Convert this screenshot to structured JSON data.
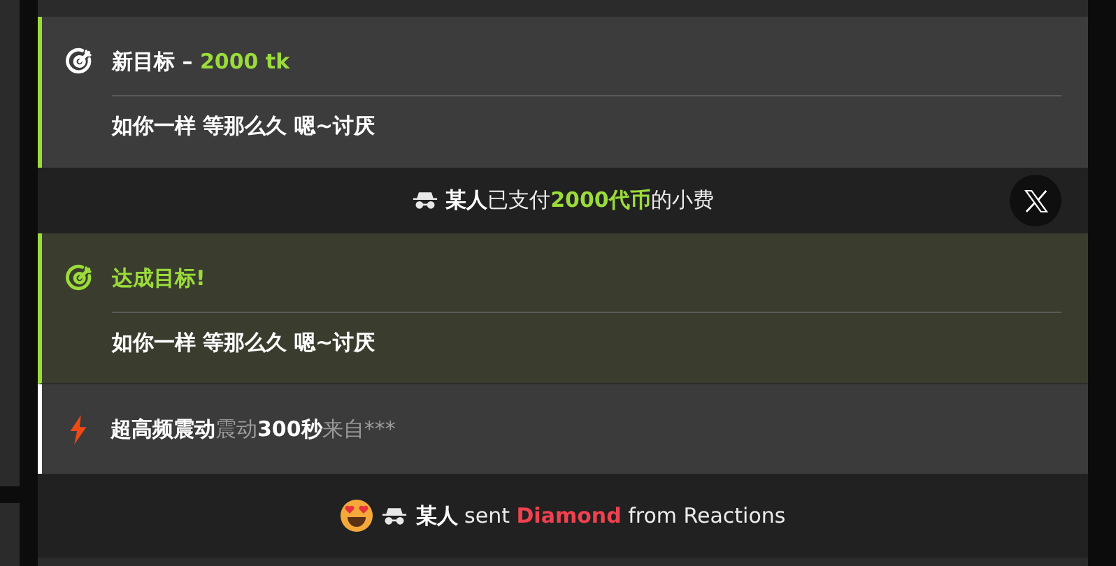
{
  "feed": [
    {
      "kind": "goal",
      "reached": false,
      "label": "新目标 – ",
      "target": "2000 tk",
      "message": "如你一样 等那么久 嗯~讨厌"
    },
    {
      "kind": "tip",
      "sender": "某人",
      "verb": "已支付",
      "amount": "2000代币",
      "suffix": "的小费"
    },
    {
      "kind": "goal",
      "reached": true,
      "label": "达成目标!",
      "message": "如你一样 等那么久 嗯~讨厌"
    },
    {
      "kind": "vibration",
      "mode": "超高频震动",
      "verb": "震动",
      "duration": "300秒",
      "source": "来自***"
    },
    {
      "kind": "reaction",
      "sender": "某人",
      "verb": " sent ",
      "gift": "Diamond",
      "source": " from Reactions"
    }
  ]
}
